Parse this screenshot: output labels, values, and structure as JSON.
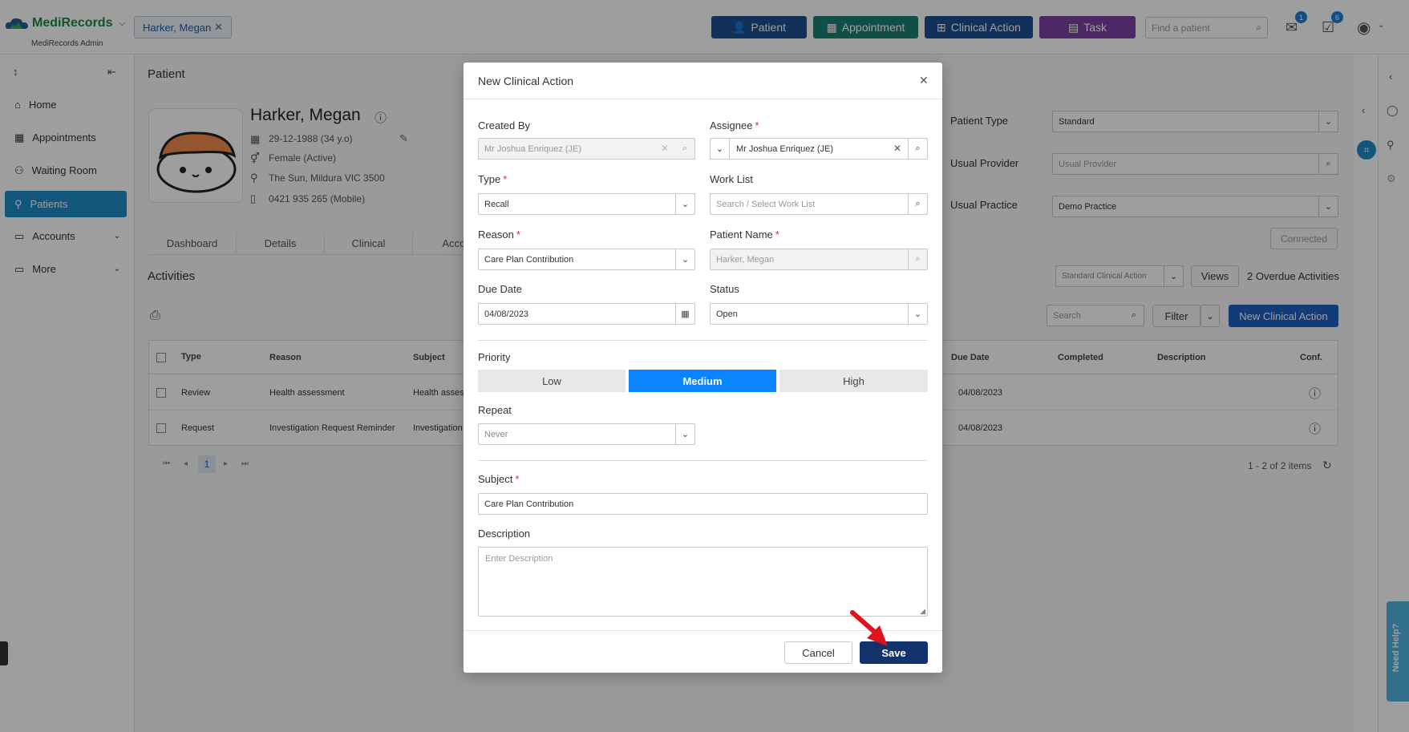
{
  "app": {
    "brand": "MediRecords",
    "subtitle": "MediRecords Admin",
    "open_tab": "Harker, Megan"
  },
  "topbar": {
    "patient_btn": "Patient",
    "appointment_btn": "Appointment",
    "clinical_action_btn": "Clinical Action",
    "task_btn": "Task",
    "find_placeholder": "Find a patient",
    "mail_badge": "1",
    "tasks_badge": "6",
    "colors": {
      "patient": "#1d4f91",
      "appointment": "#1b8070",
      "clinical_action": "#1d4f91",
      "task": "#7a3fa1"
    }
  },
  "sidebar": {
    "items": [
      {
        "label": "Home",
        "icon": "home-icon"
      },
      {
        "label": "Appointments",
        "icon": "calendar-icon"
      },
      {
        "label": "Waiting Room",
        "icon": "people-icon"
      },
      {
        "label": "Patients",
        "icon": "person-icon",
        "active": true
      },
      {
        "label": "Accounts",
        "icon": "folder-icon"
      },
      {
        "label": "More",
        "icon": "folder-icon"
      }
    ]
  },
  "patient": {
    "header": "Patient",
    "name": "Harker, Megan",
    "dob": "29-12-1988 (34 y.o)",
    "gender": "Female (Active)",
    "address": "The Sun, Mildura VIC 3500",
    "phone": "0421 935 265 (Mobile)",
    "tabs": [
      "Dashboard",
      "Details",
      "Clinical",
      "Accou"
    ],
    "type_label": "Patient Type",
    "type_value": "Standard",
    "provider_label": "Usual Provider",
    "provider_placeholder": "Usual Provider",
    "practice_label": "Usual Practice",
    "practice_value": "Demo Practice",
    "connected": "Connected"
  },
  "activities": {
    "title": "Activities",
    "filter_select": "Standard Clinical Action",
    "views": "Views",
    "overdue": "2 Overdue Activities",
    "search_placeholder": "Search",
    "filter": "Filter",
    "new_btn": "New Clinical Action",
    "columns": [
      "Type",
      "Reason",
      "Subject",
      "Due Date",
      "Completed",
      "Description",
      "Conf."
    ],
    "rows": [
      {
        "type": "Review",
        "reason": "Health assessment",
        "subject": "Health asses",
        "due": "04/08/2023"
      },
      {
        "type": "Request",
        "reason": "Investigation Request Reminder",
        "subject": "Investigation",
        "due": "04/08/2023"
      }
    ],
    "page": "1",
    "pager_info": "1 - 2 of 2 items"
  },
  "modal": {
    "title": "New Clinical Action",
    "created_by_label": "Created By",
    "created_by_value": "Mr Joshua Enriquez (JE)",
    "assignee_label": "Assignee",
    "assignee_value": "Mr Joshua Enriquez (JE)",
    "type_label": "Type",
    "type_value": "Recall",
    "worklist_label": "Work List",
    "worklist_placeholder": "Search / Select Work List",
    "reason_label": "Reason",
    "reason_value": "Care Plan Contribution",
    "patient_name_label": "Patient Name",
    "patient_name_value": "Harker, Megan",
    "due_label": "Due Date",
    "due_value": "04/08/2023",
    "status_label": "Status",
    "status_value": "Open",
    "priority_label": "Priority",
    "priority_options": [
      "Low",
      "Medium",
      "High"
    ],
    "priority_selected": "Medium",
    "repeat_label": "Repeat",
    "repeat_value": "Never",
    "subject_label": "Subject",
    "subject_value": "Care Plan Contribution",
    "description_label": "Description",
    "description_placeholder": "Enter Description",
    "cancel": "Cancel",
    "save": "Save",
    "selected_color": "#0a84ff",
    "save_color": "#12326b"
  },
  "help": {
    "label": "Need Help?"
  }
}
